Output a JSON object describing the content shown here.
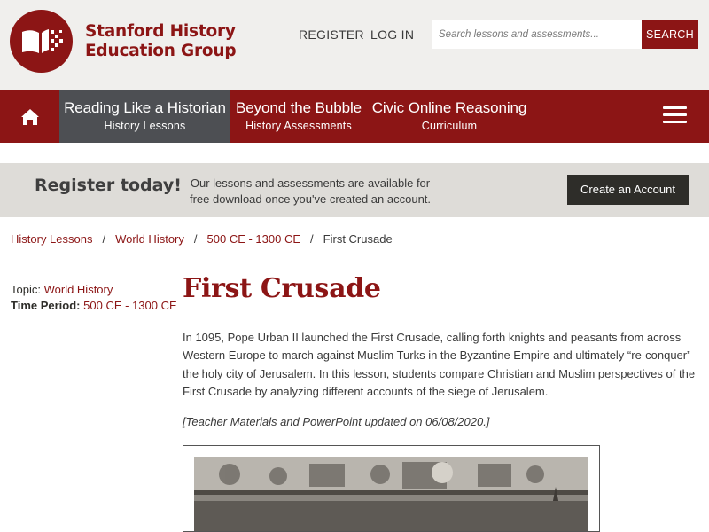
{
  "header": {
    "logo_line1": "Stanford History",
    "logo_line2": "Education Group",
    "register_link": "REGISTER",
    "login_link": "LOG IN",
    "search_placeholder": "Search lessons and assessments...",
    "search_button": "SEARCH"
  },
  "nav": {
    "items": [
      {
        "main": "Reading Like a Historian",
        "sub": "History Lessons",
        "active": true
      },
      {
        "main": "Beyond the Bubble",
        "sub": "History Assessments",
        "active": false
      },
      {
        "main": "Civic Online Reasoning",
        "sub": "Curriculum",
        "active": false
      }
    ]
  },
  "register": {
    "title": "Register today!",
    "text": "Our lessons and assessments are available for free download once you've created an account.",
    "button": "Create an Account"
  },
  "breadcrumb": [
    "History Lessons",
    "World History",
    "500 CE - 1300 CE",
    "First Crusade"
  ],
  "meta": {
    "topic_label": "Topic:",
    "topic_value": "World History",
    "period_label": "Time Period:",
    "period_value": "500 CE - 1300 CE"
  },
  "lesson": {
    "title": "First Crusade",
    "description": "In 1095, Pope Urban II launched the First Crusade, calling forth knights and peasants from across Western Europe to march against Muslim Turks in the Byzantine Empire and ultimately “re-conquer” the holy city of Jerusalem. In this lesson, students compare Christian and Muslim perspectives of the First Crusade by analyzing different accounts of the siege of Jerusalem.",
    "note": "[Teacher Materials and PowerPoint updated on 06/08/2020.]"
  },
  "colors": {
    "brand": "#8c1515",
    "nav_active": "#4d4f53",
    "register_bg": "#dedcd8",
    "header_bg": "#f0efed"
  },
  "icons": {
    "logo": "book-pixel-logo",
    "home": "home-icon",
    "menu": "hamburger-menu-icon"
  }
}
